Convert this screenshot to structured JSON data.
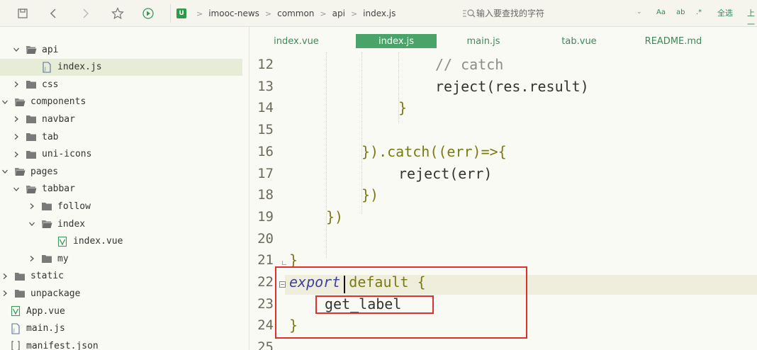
{
  "toolbar": {
    "breadcrumb": [
      "imooc-news",
      "common",
      "api",
      "index.js"
    ],
    "search_placeholder": "输入要查找的字符",
    "options": [
      "Aa",
      "ab",
      ".*"
    ],
    "select_all_label": "全选",
    "prev_label": "上一"
  },
  "sidebar": {
    "items": [
      {
        "label": "api",
        "expanded": true,
        "type": "folder"
      },
      {
        "label": "index.js",
        "type": "js-file",
        "selected": true
      },
      {
        "label": "css",
        "expanded": false,
        "type": "folder"
      },
      {
        "label": "components",
        "expanded": true,
        "type": "folder"
      },
      {
        "label": "navbar",
        "expanded": false,
        "type": "folder"
      },
      {
        "label": "tab",
        "expanded": false,
        "type": "folder"
      },
      {
        "label": "uni-icons",
        "expanded": false,
        "type": "folder"
      },
      {
        "label": "pages",
        "expanded": true,
        "type": "folder"
      },
      {
        "label": "tabbar",
        "expanded": true,
        "type": "folder"
      },
      {
        "label": "follow",
        "expanded": false,
        "type": "folder"
      },
      {
        "label": "index",
        "expanded": true,
        "type": "folder"
      },
      {
        "label": "index.vue",
        "type": "vue-file"
      },
      {
        "label": "my",
        "expanded": false,
        "type": "folder"
      },
      {
        "label": "static",
        "expanded": false,
        "type": "folder"
      },
      {
        "label": "unpackage",
        "expanded": false,
        "type": "folder"
      },
      {
        "label": "App.vue",
        "type": "vue-file"
      },
      {
        "label": "main.js",
        "type": "js-file"
      },
      {
        "label": "manifest.json",
        "type": "json-file"
      }
    ]
  },
  "editor": {
    "tabs": [
      {
        "label": "index.vue",
        "active": false
      },
      {
        "label": "index.js",
        "active": true
      },
      {
        "label": "main.js",
        "active": false
      },
      {
        "label": "tab.vue",
        "active": false
      },
      {
        "label": "README.md",
        "active": false
      }
    ],
    "lines": [
      {
        "num": "12",
        "segments": [
          {
            "t": "// catch",
            "c": "comment"
          }
        ]
      },
      {
        "num": "13",
        "segments": [
          {
            "t": "reject(res.result)",
            "c": "dark"
          }
        ]
      },
      {
        "num": "14",
        "segments": [
          {
            "t": "}",
            "c": "olive"
          }
        ]
      },
      {
        "num": "15",
        "segments": []
      },
      {
        "num": "16",
        "segments": [
          {
            "t": "}).catch((err)=>{",
            "c": "olive"
          }
        ]
      },
      {
        "num": "17",
        "segments": [
          {
            "t": "reject(err)",
            "c": "dark"
          }
        ]
      },
      {
        "num": "18",
        "segments": [
          {
            "t": "})",
            "c": "olive"
          }
        ]
      },
      {
        "num": "19",
        "segments": [
          {
            "t": "})",
            "c": "olive"
          }
        ]
      },
      {
        "num": "20",
        "segments": []
      },
      {
        "num": "21",
        "segments": [
          {
            "t": "}",
            "c": "olive"
          }
        ]
      },
      {
        "num": "22",
        "segments": [
          {
            "t": "export",
            "c": "italic"
          },
          {
            "t": " default {",
            "c": "olive"
          }
        ]
      },
      {
        "num": "23",
        "segments": [
          {
            "t": "get_label",
            "c": "dark"
          }
        ]
      },
      {
        "num": "24",
        "segments": [
          {
            "t": "}",
            "c": "olive"
          }
        ]
      },
      {
        "num": "25",
        "segments": []
      }
    ]
  },
  "colors": {
    "accent_green": "#4aa368",
    "highlight_red": "#e0302e",
    "keyword_blue": "#3f3fa0",
    "olive": "#7a7a14"
  }
}
